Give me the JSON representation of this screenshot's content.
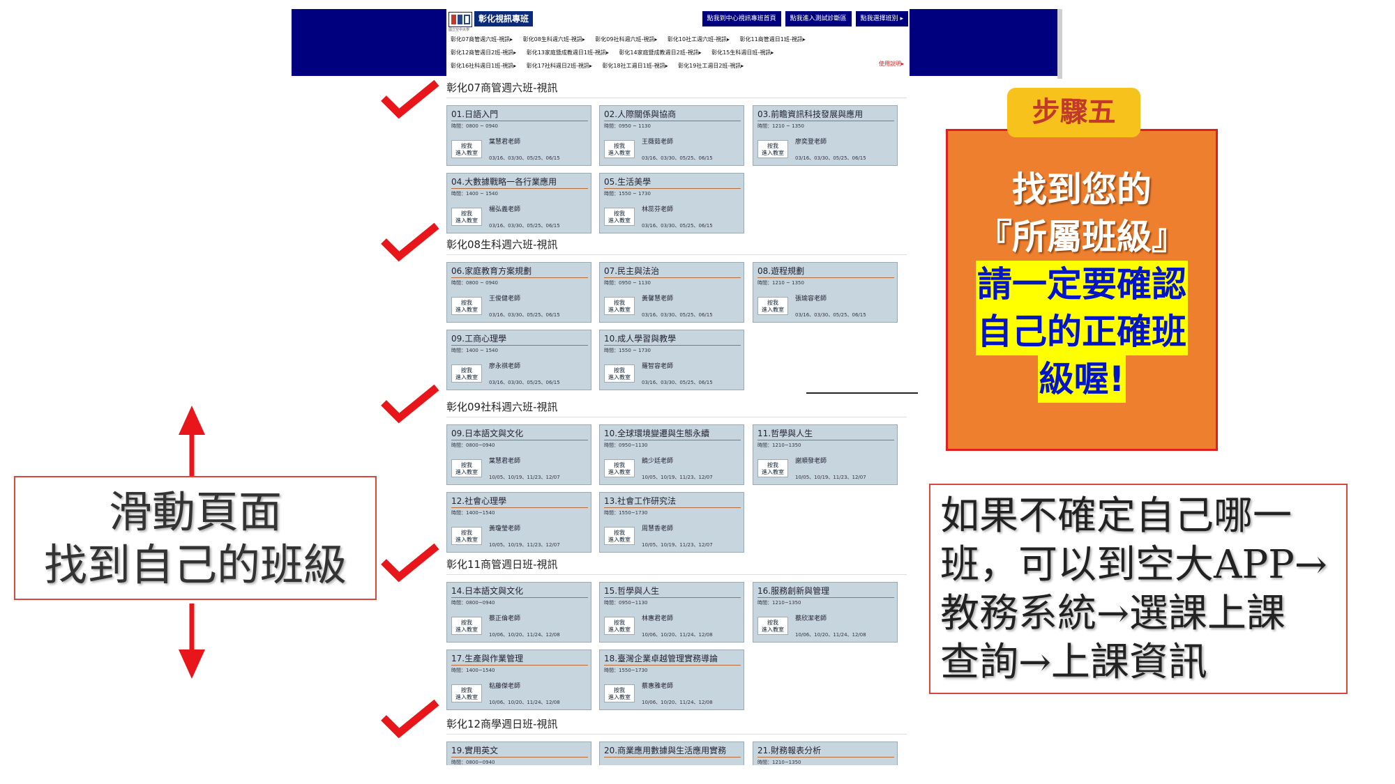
{
  "header": {
    "logo_text": "國立空中大學",
    "brand": "彰化視訊專班",
    "top_links": [
      "點我到中心視訊專班首頁",
      "點我進入測試診斷區",
      "點我選擇班別 ▸"
    ],
    "class_nav_rows": [
      [
        "彰化07商管週六班-視訊▸",
        "彰化08生科週六班-視訊▸",
        "彰化09社科週六班-視訊▸",
        "彰化10社工週六班-視訊▸",
        "彰化11商管週日1班-視訊▸"
      ],
      [
        "彰化12商管週日2班-視訊▸",
        "彰化13家庭暨成教週日1班-視訊▸",
        "彰化14家庭暨成教週日2班-視訊▸",
        "彰化15生科週日班-視訊▸"
      ],
      [
        "彰化16社科週日1班-視訊▸",
        "彰化17社科週日2班-視訊▸",
        "彰化18社工週日1班-視訊▸",
        "彰化19社工週日2班-視訊▸"
      ]
    ],
    "usage_link": "使用說明▸"
  },
  "sections": [
    {
      "title": "彰化07商管週六班-視訊",
      "courses": [
        {
          "title": "01.日語入門",
          "time": "時間：0800 ~ 0940",
          "teacher": "葉慧君老師",
          "dates": "03/16、03/30、05/25、06/15"
        },
        {
          "title": "02.人際關係與協商",
          "time": "時間：0950 ~ 1130",
          "teacher": "王薇茹老師",
          "dates": "03/16、03/30、05/25、06/15"
        },
        {
          "title": "03.前瞻資訊科技發展與應用",
          "time": "時間：1210 ~ 1350",
          "teacher": "廖奕登老師",
          "dates": "03/16、03/30、05/25、06/15"
        },
        {
          "title": "04.大數據戰略一各行業應用",
          "time": "時間：1400 ~ 1540",
          "teacher": "楊弘義老師",
          "dates": "03/16、03/30、05/25、06/15"
        },
        {
          "title": "05.生活美學",
          "time": "時間：1550 ~ 1730",
          "teacher": "林蕊芬老師",
          "dates": "03/16、03/30、05/25、06/15"
        }
      ]
    },
    {
      "title": "彰化08生科週六班-視訊",
      "courses": [
        {
          "title": "06.家庭教育方案規劃",
          "time": "時間：0800 ~ 0940",
          "teacher": "王俊健老師",
          "dates": "03/16、03/30、05/25、06/15"
        },
        {
          "title": "07.民主與法治",
          "time": "時間：0950 ~ 1130",
          "teacher": "黃馨慧老師",
          "dates": "03/16、03/30、05/25、06/15"
        },
        {
          "title": "08.遊程規劃",
          "time": "時間：1210 ~ 1350",
          "teacher": "張瑜容老師",
          "dates": "03/16、03/30、05/25、06/15"
        },
        {
          "title": "09.工商心理學",
          "time": "時間：1400 ~ 1540",
          "teacher": "廖永祺老師",
          "dates": "03/16、03/30、05/25、06/15"
        },
        {
          "title": "10.成人學習與教學",
          "time": "時間：1550 ~ 1730",
          "teacher": "羅智容老師",
          "dates": "03/16、03/30、05/25、06/15"
        }
      ]
    },
    {
      "title": "彰化09社科週六班-視訊",
      "courses": [
        {
          "title": "09.日本語文與文化",
          "time": "時間：0800~0940",
          "teacher": "葉慧君老師",
          "dates": "10/05、10/19、11/23、12/07"
        },
        {
          "title": "10.全球環境變遷與生態永續",
          "time": "時間：0950~1130",
          "teacher": "饒少廷老師",
          "dates": "10/05、10/19、11/23、12/07"
        },
        {
          "title": "11.哲學與人生",
          "time": "時間：1210~1350",
          "teacher": "謝順發老師",
          "dates": "10/05、10/19、11/23、12/07"
        },
        {
          "title": "12.社會心理學",
          "time": "時間：1400~1540",
          "teacher": "黃瓊瑩老師",
          "dates": "10/05、10/19、11/23、12/07"
        },
        {
          "title": "13.社會工作研究法",
          "time": "時間：1550~1730",
          "teacher": "周慧香老師",
          "dates": "10/05、10/19、11/23、12/07"
        }
      ]
    },
    {
      "title": "彰化11商管週日班-視訊",
      "courses": [
        {
          "title": "14.日本語文與文化",
          "time": "時間：0800~0940",
          "teacher": "蔡正倫老師",
          "dates": "10/06、10/20、11/24、12/08"
        },
        {
          "title": "15.哲學與人生",
          "time": "時間：0950~1130",
          "teacher": "林惠君老師",
          "dates": "10/06、10/20、11/24、12/08"
        },
        {
          "title": "16.服務創新與管理",
          "time": "時間：1210~1350",
          "teacher": "蔡欣潔老師",
          "dates": "10/06、10/20、11/24、12/08"
        },
        {
          "title": "17.生產與作業管理",
          "time": "時間：1400~1540",
          "teacher": "粘藤傑老師",
          "dates": "10/06、10/20、11/24、12/08"
        },
        {
          "title": "18.臺灣企業卓越管理實務導論",
          "time": "時間：1550~1730",
          "teacher": "蔡惠雅老師",
          "dates": "10/06、10/20、11/24、12/08"
        }
      ]
    },
    {
      "title": "彰化12商學週日班-視訊",
      "courses": [
        {
          "title": "19.實用英文",
          "time": "時間：0800~0940",
          "teacher": "",
          "dates": ""
        },
        {
          "title": "20.商業應用數據與生活應用實務",
          "time": "",
          "teacher": "",
          "dates": ""
        },
        {
          "title": "21.財務報表分析",
          "time": "時間：1210~1350",
          "teacher": "",
          "dates": ""
        }
      ]
    }
  ],
  "enter_button": "按我\n進入教室",
  "scroll_hint": {
    "line1": "滑動頁面",
    "line2": "找到自己的班級"
  },
  "step": {
    "tag": "步驟五",
    "line1": "找到您的",
    "line2": "『所屬班級』",
    "hl1": "請一定要確認",
    "hl2": "自己的正確班",
    "hl3": "級喔!"
  },
  "info": {
    "line1": "如果不確定自己哪一",
    "line2": "班，可以到空大APP→",
    "line3": "教務系統→選課上課",
    "line4": "查詢→上課資訊"
  },
  "colors": {
    "header_bg": "#00007e",
    "card_bg": "#c7d5df",
    "check_red": "#e8161b",
    "step_orange": "#ee7f2e",
    "step_tag": "#f7c21c",
    "highlight": "#ffff00"
  }
}
